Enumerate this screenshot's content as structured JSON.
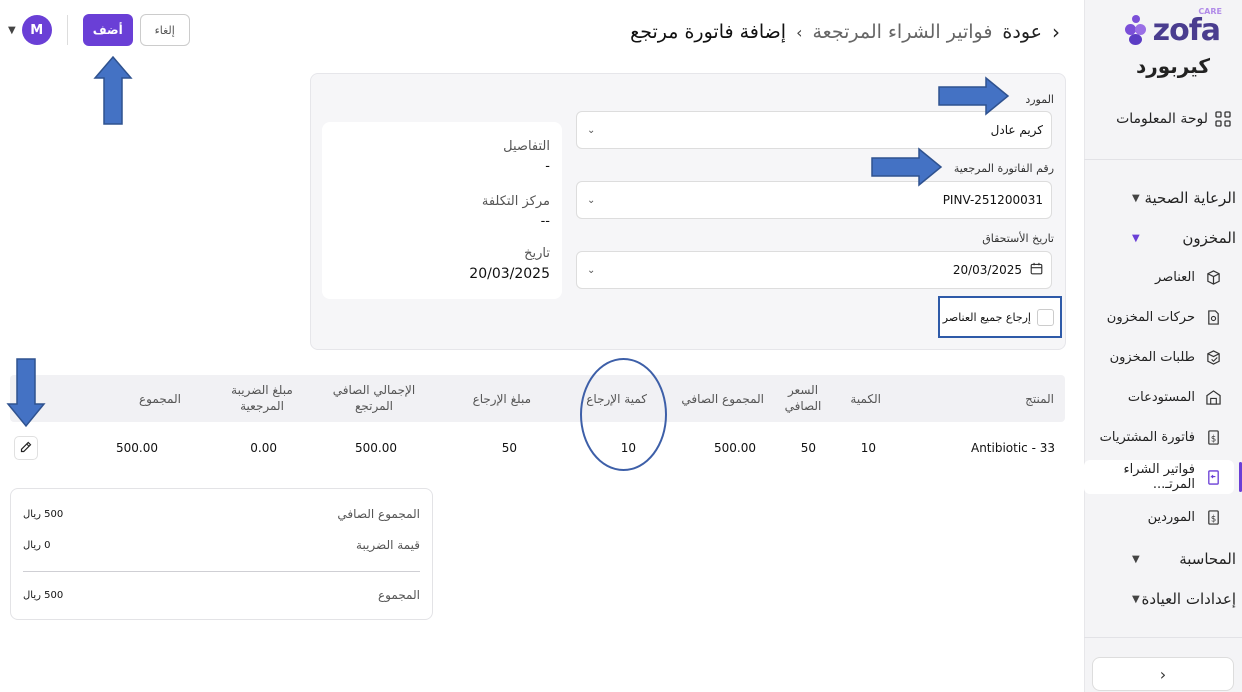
{
  "sidebar": {
    "logo_text": "zofa",
    "logo_badge": "CARE",
    "clinic_name": "كيربورد",
    "dashboard": "لوحة المعلومات",
    "groups": {
      "health": "الرعاية الصحية",
      "inventory": "المخزون",
      "accounting": "المحاسبة",
      "clinic_settings": "إعدادات العيادة"
    },
    "inventory_items": {
      "items": "العناصر",
      "movements": "حركات المخزون",
      "requests": "طلبات المخزون",
      "warehouses": "المستودعات",
      "purchase_invoice": "فاتورة المشتريات",
      "purchase_returns": "فواتير الشراء المرتـ...",
      "suppliers": "الموردين"
    }
  },
  "header": {
    "back": "عودة",
    "crumb": "فواتير الشراء المرتجعة",
    "current": "إضافة فاتورة مرتجع",
    "add_button": "أضف",
    "cancel_button": "إلغاء",
    "avatar_initial": "M"
  },
  "form": {
    "supplier_label": "المورد",
    "supplier_value": "كريم عادل",
    "ref_invoice_label": "رقم الفاتورة المرجعية",
    "ref_invoice_value": "PINV-251200031",
    "due_date_label": "تاريخ الأستحقاق",
    "due_date_value": "20/03/2025",
    "return_all_label": "إرجاع جميع العناصر"
  },
  "details": {
    "details_label": "التفاصيل",
    "details_value": "-",
    "cost_center_label": "مركز التكلفة",
    "cost_center_value": "--",
    "date_label": "تاريخ",
    "date_value": "20/03/2025"
  },
  "table": {
    "headers": {
      "product": "المنتج",
      "qty": "الكمية",
      "net_price": "السعر الصافي",
      "net_total": "المجموع الصافي",
      "return_qty": "كمية الإرجاع",
      "return_amount": "مبلغ الإرجاع",
      "net_total_returned": "الإجمالي الصافي المرتجع",
      "ref_tax": "مبلغ الضريبة المرجعية",
      "total": "المجموع"
    },
    "row": {
      "product": "Antibiotic - 33",
      "qty": "10",
      "net_price": "50",
      "net_total": "500.00",
      "return_qty": "10",
      "return_amount": "50",
      "net_total_returned": "500.00",
      "ref_tax": "0.00",
      "total": "500.00"
    }
  },
  "summary": {
    "net_total_label": "المجموع الصافي",
    "net_total_value": "500 ريال",
    "tax_label": "قيمة الضريبة",
    "tax_value": "0 ريال",
    "total_label": "المجموع",
    "total_value": "500 ريال"
  },
  "colors": {
    "accent": "#6a3fd6",
    "annotation": "#4472c4"
  }
}
